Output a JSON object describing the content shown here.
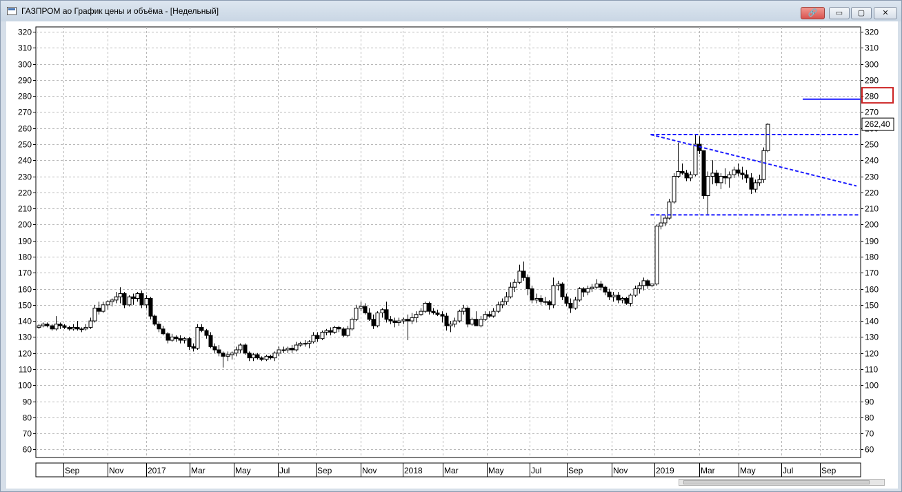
{
  "window": {
    "title": "ГАЗПРОМ ао График цены и объёма - [Недельный]",
    "buttons": {
      "link": "🔗",
      "minimize": "▭",
      "maximize": "▢",
      "close": "✕"
    }
  },
  "colors": {
    "accent": "#cc2222",
    "trendline": "#1a1aff",
    "grid": "#b9b9b9"
  },
  "chart_data": {
    "type": "candlestick",
    "ylim": [
      55,
      323
    ],
    "grid": true,
    "y_ticks": [
      60,
      70,
      80,
      90,
      100,
      110,
      120,
      130,
      140,
      150,
      160,
      170,
      180,
      190,
      200,
      210,
      220,
      230,
      240,
      250,
      260,
      270,
      280,
      290,
      300,
      310,
      320
    ],
    "x_labels": [
      "Sep",
      "Nov",
      "2017",
      "Mar",
      "May",
      "Jul",
      "Sep",
      "Nov",
      "2018",
      "Mar",
      "May",
      "Jul",
      "Sep",
      "Nov",
      "2019",
      "Mar",
      "May",
      "Jul",
      "Sep"
    ],
    "last_price_label": "262,40",
    "highlighted_level": "280",
    "series": [
      {
        "values": [
          [
            136,
            138,
            135,
            137
          ],
          [
            137,
            139,
            136,
            138
          ],
          [
            138,
            139,
            136,
            137
          ],
          [
            137,
            138,
            134,
            135
          ],
          [
            135,
            143,
            134,
            138
          ],
          [
            138,
            139,
            135,
            137
          ],
          [
            137,
            138,
            135,
            136
          ],
          [
            136,
            137,
            134,
            135
          ],
          [
            135,
            138,
            134,
            136
          ],
          [
            136,
            140,
            134,
            135
          ],
          [
            135,
            136,
            133,
            135
          ],
          [
            135,
            138,
            134,
            136
          ],
          [
            136,
            142,
            135,
            140
          ],
          [
            140,
            150,
            139,
            148
          ],
          [
            148,
            152,
            144,
            146
          ],
          [
            146,
            152,
            145,
            150
          ],
          [
            150,
            153,
            147,
            152
          ],
          [
            152,
            154,
            149,
            153
          ],
          [
            153,
            158,
            151,
            155
          ],
          [
            155,
            161,
            151,
            157
          ],
          [
            157,
            158,
            148,
            150
          ],
          [
            150,
            156,
            149,
            155
          ],
          [
            155,
            157,
            150,
            154
          ],
          [
            154,
            158,
            152,
            157
          ],
          [
            157,
            159,
            148,
            150
          ],
          [
            150,
            156,
            148,
            154
          ],
          [
            154,
            155,
            141,
            143
          ],
          [
            143,
            144,
            137,
            138
          ],
          [
            138,
            140,
            133,
            135
          ],
          [
            135,
            137,
            131,
            132
          ],
          [
            132,
            133,
            126,
            128
          ],
          [
            128,
            132,
            127,
            130
          ],
          [
            130,
            131,
            127,
            129
          ],
          [
            129,
            131,
            126,
            128
          ],
          [
            128,
            130,
            126,
            129
          ],
          [
            129,
            130,
            122,
            124
          ],
          [
            124,
            126,
            121,
            123
          ],
          [
            123,
            138,
            122,
            136
          ],
          [
            136,
            138,
            133,
            134
          ],
          [
            134,
            135,
            129,
            131
          ],
          [
            131,
            133,
            123,
            124
          ],
          [
            124,
            126,
            120,
            122
          ],
          [
            122,
            125,
            118,
            120
          ],
          [
            120,
            121,
            111,
            118
          ],
          [
            118,
            121,
            115,
            119
          ],
          [
            119,
            121,
            116,
            120
          ],
          [
            120,
            124,
            118,
            122
          ],
          [
            122,
            126,
            120,
            125
          ],
          [
            125,
            126,
            119,
            120
          ],
          [
            120,
            121,
            115,
            117
          ],
          [
            117,
            120,
            115,
            119
          ],
          [
            119,
            120,
            116,
            117
          ],
          [
            117,
            118,
            115,
            116
          ],
          [
            116,
            119,
            115,
            118
          ],
          [
            118,
            119,
            116,
            117
          ],
          [
            117,
            121,
            115,
            120
          ],
          [
            120,
            124,
            118,
            122
          ],
          [
            122,
            124,
            120,
            122
          ],
          [
            122,
            124,
            120,
            123
          ],
          [
            123,
            125,
            120,
            122
          ],
          [
            122,
            127,
            121,
            125
          ],
          [
            125,
            127,
            124,
            126
          ],
          [
            126,
            128,
            124,
            126
          ],
          [
            126,
            128,
            123,
            127
          ],
          [
            127,
            133,
            126,
            131
          ],
          [
            131,
            133,
            127,
            129
          ],
          [
            129,
            134,
            128,
            133
          ],
          [
            133,
            135,
            131,
            134
          ],
          [
            134,
            136,
            131,
            133
          ],
          [
            133,
            137,
            132,
            136
          ],
          [
            136,
            137,
            133,
            135
          ],
          [
            135,
            136,
            130,
            131
          ],
          [
            131,
            137,
            130,
            135
          ],
          [
            135,
            142,
            134,
            141
          ],
          [
            141,
            150,
            140,
            148
          ],
          [
            148,
            152,
            146,
            149
          ],
          [
            149,
            151,
            144,
            145
          ],
          [
            145,
            148,
            140,
            141
          ],
          [
            141,
            144,
            135,
            137
          ],
          [
            137,
            146,
            136,
            145
          ],
          [
            145,
            148,
            142,
            147
          ],
          [
            147,
            152,
            139,
            141
          ],
          [
            141,
            143,
            138,
            140
          ],
          [
            140,
            142,
            136,
            139
          ],
          [
            139,
            142,
            137,
            140
          ],
          [
            140,
            142,
            138,
            141
          ],
          [
            141,
            144,
            128,
            140
          ],
          [
            140,
            145,
            138,
            142
          ],
          [
            142,
            146,
            139,
            144
          ],
          [
            144,
            148,
            143,
            146
          ],
          [
            146,
            152,
            145,
            151
          ],
          [
            151,
            152,
            144,
            146
          ],
          [
            146,
            148,
            144,
            145
          ],
          [
            145,
            147,
            143,
            144
          ],
          [
            144,
            146,
            139,
            143
          ],
          [
            143,
            145,
            134,
            137
          ],
          [
            137,
            140,
            133,
            138
          ],
          [
            138,
            142,
            136,
            140
          ],
          [
            140,
            147,
            139,
            146
          ],
          [
            146,
            150,
            144,
            148
          ],
          [
            148,
            149,
            136,
            138
          ],
          [
            138,
            142,
            137,
            141
          ],
          [
            141,
            146,
            138,
            137
          ],
          [
            137,
            143,
            136,
            141
          ],
          [
            141,
            146,
            140,
            144
          ],
          [
            144,
            146,
            142,
            143
          ],
          [
            143,
            148,
            142,
            146
          ],
          [
            146,
            152,
            145,
            150
          ],
          [
            150,
            154,
            148,
            152
          ],
          [
            152,
            158,
            150,
            155
          ],
          [
            155,
            164,
            154,
            161
          ],
          [
            161,
            166,
            158,
            164
          ],
          [
            164,
            175,
            163,
            171
          ],
          [
            171,
            177,
            165,
            167
          ],
          [
            167,
            169,
            156,
            160
          ],
          [
            160,
            162,
            151,
            153
          ],
          [
            153,
            157,
            151,
            154
          ],
          [
            154,
            156,
            150,
            152
          ],
          [
            152,
            155,
            150,
            152
          ],
          [
            152,
            153,
            147,
            150
          ],
          [
            150,
            167,
            148,
            162
          ],
          [
            162,
            165,
            159,
            163
          ],
          [
            163,
            164,
            153,
            155
          ],
          [
            155,
            157,
            149,
            151
          ],
          [
            151,
            154,
            145,
            148
          ],
          [
            148,
            155,
            147,
            153
          ],
          [
            153,
            161,
            152,
            160
          ],
          [
            160,
            161,
            155,
            158
          ],
          [
            158,
            162,
            156,
            160
          ],
          [
            160,
            163,
            158,
            161
          ],
          [
            161,
            166,
            160,
            163
          ],
          [
            163,
            165,
            159,
            161
          ],
          [
            161,
            162,
            156,
            158
          ],
          [
            158,
            160,
            153,
            155
          ],
          [
            155,
            158,
            152,
            156
          ],
          [
            156,
            158,
            151,
            153
          ],
          [
            153,
            155,
            151,
            154
          ],
          [
            154,
            155,
            150,
            151
          ],
          [
            151,
            157,
            149,
            156
          ],
          [
            156,
            162,
            155,
            160
          ],
          [
            160,
            164,
            157,
            162
          ],
          [
            162,
            167,
            159,
            165
          ],
          [
            165,
            166,
            160,
            162
          ],
          [
            162,
            163,
            161,
            163
          ],
          [
            163,
            200,
            162,
            199
          ],
          [
            199,
            206,
            197,
            201
          ],
          [
            201,
            206,
            199,
            204
          ],
          [
            204,
            216,
            203,
            214
          ],
          [
            214,
            232,
            213,
            230
          ],
          [
            230,
            251,
            229,
            233
          ],
          [
            233,
            238,
            231,
            232
          ],
          [
            232,
            234,
            227,
            229
          ],
          [
            229,
            233,
            227,
            231
          ],
          [
            231,
            256,
            230,
            250
          ],
          [
            250,
            255,
            244,
            246
          ],
          [
            246,
            246,
            216,
            218
          ],
          [
            218,
            233,
            206,
            230
          ],
          [
            230,
            240,
            225,
            232
          ],
          [
            232,
            234,
            224,
            226
          ],
          [
            226,
            232,
            222,
            230
          ],
          [
            230,
            235,
            225,
            229
          ],
          [
            229,
            233,
            223,
            231
          ],
          [
            231,
            236,
            229,
            234
          ],
          [
            234,
            238,
            230,
            232
          ],
          [
            232,
            236,
            228,
            231
          ],
          [
            231,
            234,
            226,
            229
          ],
          [
            229,
            232,
            219,
            222
          ],
          [
            222,
            228,
            220,
            226
          ],
          [
            226,
            231,
            224,
            228
          ],
          [
            228,
            248,
            226,
            246
          ],
          [
            246,
            263,
            245,
            262.4
          ]
        ]
      }
    ],
    "annotations": {
      "dashed_levels": [
        256,
        206
      ],
      "dashed_trendline": {
        "from_index": 143,
        "from_value": 256,
        "to_value": 224
      },
      "resistance_line": 278
    }
  }
}
